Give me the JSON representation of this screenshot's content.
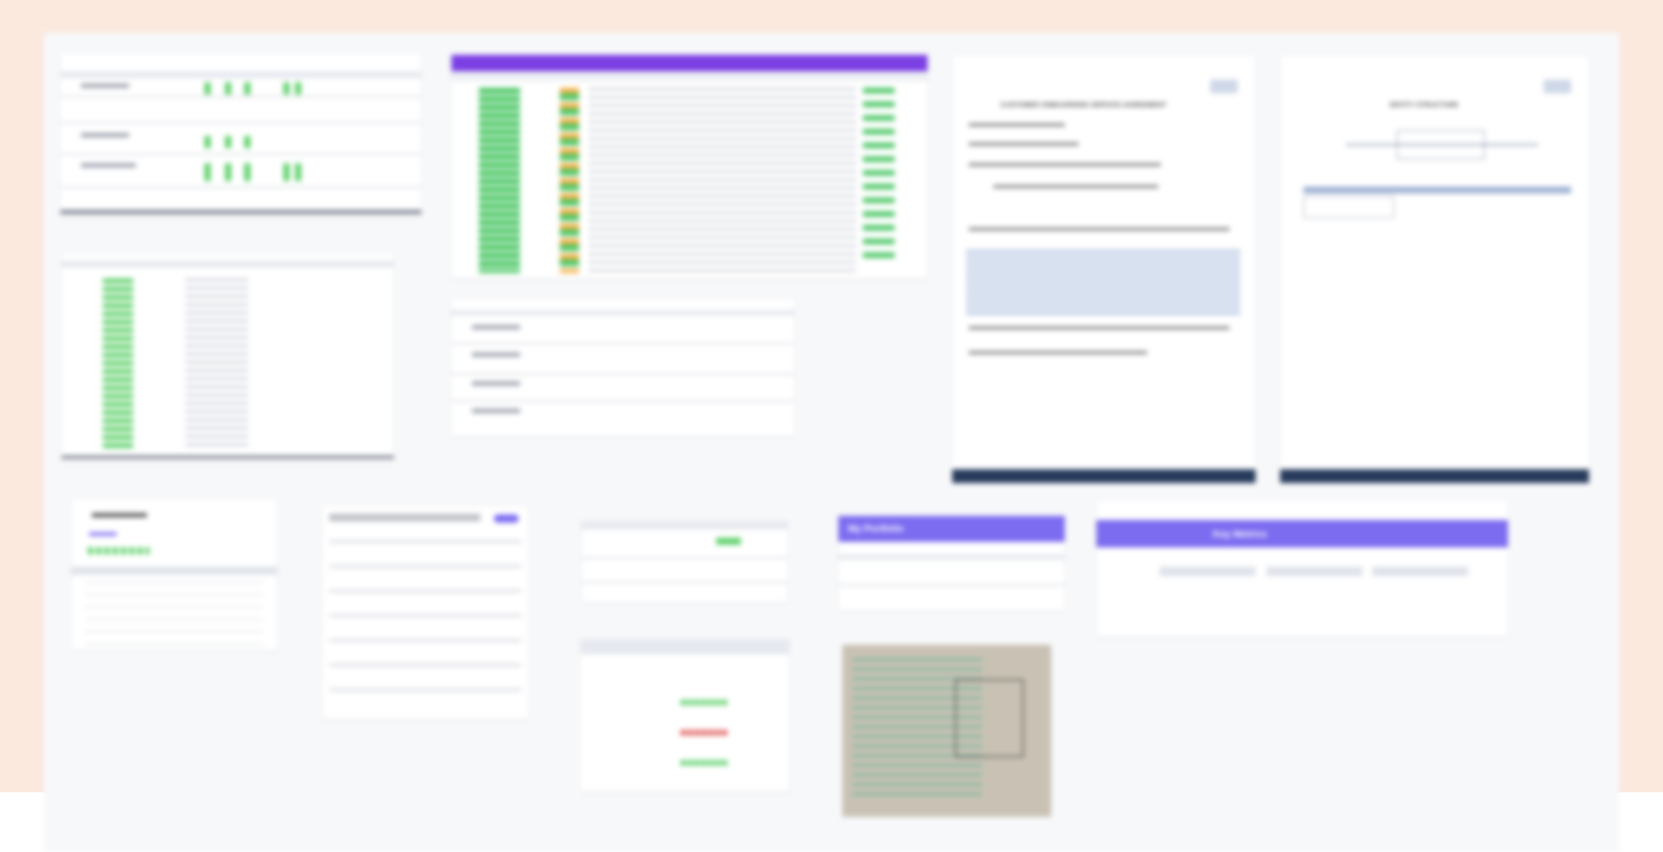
{
  "kanban": {
    "title_left": "My Portfolio",
    "title_right": "Key Metrics"
  },
  "documents": {
    "doc1_title": "CUSTOMER ONBOARDING SERVICE AGREEMENT",
    "doc2_title": "ENTITY STRUCTURE"
  },
  "colors": {
    "background": "#fbe9de",
    "board": "#f7f8fa",
    "accent_purple": "#7b3fe4",
    "accent_violet": "#7c6cf0",
    "status_green": "#5fd06b",
    "status_orange": "#f5b24a",
    "doc_footer": "#263a5c"
  },
  "icons": [
    "logo-icon",
    "status-dot-icon",
    "whiteboard-photo"
  ]
}
